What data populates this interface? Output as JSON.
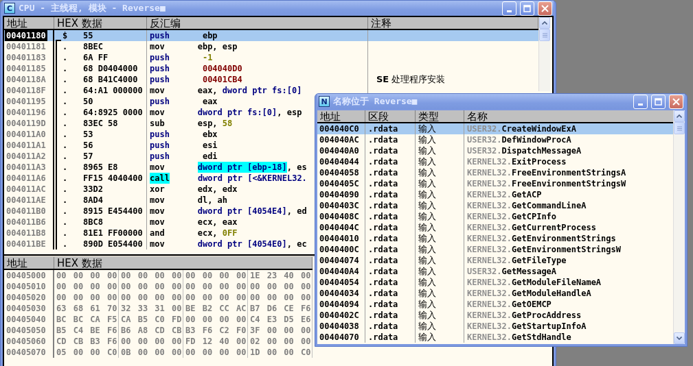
{
  "cpu_window": {
    "icon": "C",
    "title": "CPU -  主线程, 模块 - Reverse■",
    "disasm": {
      "columns": [
        "地址",
        "HEX 数据",
        "反汇编",
        "注释"
      ],
      "rows": [
        {
          "address": "00401180",
          "marker": "$",
          "bracket_start": true,
          "hex": "55",
          "op": "push",
          "kind": "stack",
          "op_highlight": false,
          "operands": [
            {
              "text": "ebp",
              "kind": "reg",
              "highlight": false
            }
          ],
          "selected": true
        },
        {
          "address": "00401181",
          "marker": ".",
          "bracket_start": false,
          "hex": "8BEC",
          "op": "mov",
          "kind": "plain",
          "op_highlight": false,
          "operands": [
            {
              "text": "ebp, esp",
              "kind": "reg",
              "highlight": false
            }
          ],
          "selected": false
        },
        {
          "address": "00401183",
          "marker": ".",
          "bracket_start": false,
          "hex": "6A FF",
          "op": "push",
          "kind": "stack",
          "op_highlight": false,
          "operands": [
            {
              "text": "-1",
              "kind": "imm",
              "highlight": false
            }
          ],
          "selected": false
        },
        {
          "address": "00401185",
          "marker": ".",
          "bracket_start": false,
          "hex": "68 D0404000",
          "op": "push",
          "kind": "stack",
          "op_highlight": false,
          "operands": [
            {
              "text": "004040D0",
              "kind": "addr",
              "highlight": false
            }
          ],
          "selected": false
        },
        {
          "address": "0040118A",
          "marker": ".",
          "bracket_start": false,
          "hex": "68 B41C4000",
          "op": "push",
          "kind": "stack",
          "op_highlight": false,
          "operands": [
            {
              "text": "00401CB4",
              "kind": "addr",
              "highlight": false
            }
          ],
          "comment": "**SE** 处理程序安装",
          "selected": false
        },
        {
          "address": "0040118F",
          "marker": ".",
          "bracket_start": false,
          "hex": "64:A1 000000",
          "op": "mov",
          "kind": "plain",
          "op_highlight": false,
          "operands": [
            {
              "text": "eax, ",
              "kind": "reg",
              "highlight": false
            },
            {
              "text": "dword ptr fs:[0]",
              "kind": "mem",
              "highlight": false
            }
          ],
          "selected": false
        },
        {
          "address": "00401195",
          "marker": ".",
          "bracket_start": false,
          "hex": "50",
          "op": "push",
          "kind": "stack",
          "op_highlight": false,
          "operands": [
            {
              "text": "eax",
              "kind": "reg",
              "highlight": false
            }
          ],
          "selected": false
        },
        {
          "address": "00401196",
          "marker": ".",
          "bracket_start": false,
          "hex": "64:8925 0000",
          "op": "mov",
          "kind": "plain",
          "op_highlight": false,
          "operands": [
            {
              "text": "dword ptr fs:[0]",
              "kind": "mem",
              "highlight": false
            },
            {
              "text": ", esp",
              "kind": "reg",
              "highlight": false
            }
          ],
          "selected": false
        },
        {
          "address": "0040119D",
          "marker": ".",
          "bracket_start": false,
          "hex": "83EC 58",
          "op": "sub",
          "kind": "plain",
          "op_highlight": false,
          "operands": [
            {
              "text": "esp, ",
              "kind": "reg",
              "highlight": false
            },
            {
              "text": "58",
              "kind": "imm",
              "highlight": false
            }
          ],
          "selected": false
        },
        {
          "address": "004011A0",
          "marker": ".",
          "bracket_start": false,
          "hex": "53",
          "op": "push",
          "kind": "stack",
          "op_highlight": false,
          "operands": [
            {
              "text": "ebx",
              "kind": "reg",
              "highlight": false
            }
          ],
          "selected": false
        },
        {
          "address": "004011A1",
          "marker": ".",
          "bracket_start": false,
          "hex": "56",
          "op": "push",
          "kind": "stack",
          "op_highlight": false,
          "operands": [
            {
              "text": "esi",
              "kind": "reg",
              "highlight": false
            }
          ],
          "selected": false
        },
        {
          "address": "004011A2",
          "marker": ".",
          "bracket_start": false,
          "hex": "57",
          "op": "push",
          "kind": "stack",
          "op_highlight": false,
          "operands": [
            {
              "text": "edi",
              "kind": "reg",
              "highlight": false
            }
          ],
          "selected": false
        },
        {
          "address": "004011A3",
          "marker": ".",
          "bracket_start": false,
          "hex": "8965 E8",
          "op": "mov",
          "kind": "plain",
          "op_highlight": false,
          "operands": [
            {
              "text": "dword ptr [ebp-18]",
              "kind": "mem",
              "highlight": true
            },
            {
              "text": ", es",
              "kind": "reg",
              "highlight": false
            }
          ],
          "selected": false
        },
        {
          "address": "004011A6",
          "marker": ".",
          "bracket_start": false,
          "hex": "FF15 4040400",
          "op": "call",
          "kind": "plain",
          "op_highlight": true,
          "operands": [
            {
              "text": "dword ptr [<&KERNEL32.",
              "kind": "mem",
              "highlight": false
            }
          ],
          "selected": false
        },
        {
          "address": "004011AC",
          "marker": ".",
          "bracket_start": false,
          "hex": "33D2",
          "op": "xor",
          "kind": "plain",
          "op_highlight": false,
          "operands": [
            {
              "text": "edx, edx",
              "kind": "reg",
              "highlight": false
            }
          ],
          "selected": false
        },
        {
          "address": "004011AE",
          "marker": ".",
          "bracket_start": false,
          "hex": "8AD4",
          "op": "mov",
          "kind": "plain",
          "op_highlight": false,
          "operands": [
            {
              "text": "dl, ah",
              "kind": "reg",
              "highlight": false
            }
          ],
          "selected": false
        },
        {
          "address": "004011B0",
          "marker": ".",
          "bracket_start": false,
          "hex": "8915 E454400",
          "op": "mov",
          "kind": "plain",
          "op_highlight": false,
          "operands": [
            {
              "text": "dword ptr [4054E4]",
              "kind": "mem",
              "highlight": false
            },
            {
              "text": ", ed",
              "kind": "reg",
              "highlight": false
            }
          ],
          "selected": false
        },
        {
          "address": "004011B6",
          "marker": ".",
          "bracket_start": false,
          "hex": "8BC8",
          "op": "mov",
          "kind": "plain",
          "op_highlight": false,
          "operands": [
            {
              "text": "ecx, eax",
              "kind": "reg",
              "highlight": false
            }
          ],
          "selected": false
        },
        {
          "address": "004011B8",
          "marker": ".",
          "bracket_start": false,
          "hex": "81E1 FF00000",
          "op": "and",
          "kind": "plain",
          "op_highlight": false,
          "operands": [
            {
              "text": "ecx, ",
              "kind": "reg",
              "highlight": false
            },
            {
              "text": "0FF",
              "kind": "imm",
              "highlight": false
            }
          ],
          "selected": false
        },
        {
          "address": "004011BE",
          "marker": ".",
          "bracket_start": false,
          "hex": "890D E054400",
          "op": "mov",
          "kind": "plain",
          "op_highlight": false,
          "operands": [
            {
              "text": "dword ptr [4054E0]",
              "kind": "mem",
              "highlight": false
            },
            {
              "text": ", ec",
              "kind": "reg",
              "highlight": false
            }
          ],
          "selected": false
        }
      ]
    },
    "dump": {
      "columns": [
        "地址",
        "HEX 数据"
      ],
      "rows": [
        {
          "address": "00405000",
          "groups": [
            "00 00 00 00",
            "00 00 00 00",
            "00 00 00 00",
            "1E 23 40 00"
          ]
        },
        {
          "address": "00405010",
          "groups": [
            "00 00 00 00",
            "00 00 00 00",
            "00 00 00 00",
            "00 00 00 00"
          ]
        },
        {
          "address": "00405020",
          "groups": [
            "00 00 00 00",
            "00 00 00 00",
            "00 00 00 00",
            "00 00 00 00"
          ]
        },
        {
          "address": "00405030",
          "groups": [
            "63 68 61 70",
            "32 33 31 00",
            "BE B2 CC AC",
            "B7 D6 CE F6"
          ]
        },
        {
          "address": "00405040",
          "groups": [
            "BC BC CA F5",
            "CA B5 C0 FD",
            "00 00 00 00",
            "C4 E3 D5 E6"
          ]
        },
        {
          "address": "00405050",
          "groups": [
            "B5 C4 BE F6",
            "B6 A8 CD CB",
            "B3 F6 C2 F0",
            "3F 00 00 00"
          ]
        },
        {
          "address": "00405060",
          "groups": [
            "CD CB B3 F6",
            "00 00 00 00",
            "FD 12 40 00",
            "02 00 00 00"
          ]
        },
        {
          "address": "00405070",
          "groups": [
            "05 00 00 C0",
            "0B 00 00 00",
            "00 00 00 00",
            "1D 00 00 C0"
          ]
        }
      ]
    }
  },
  "names_window": {
    "icon": "N",
    "title": "名称位于 Reverse■",
    "columns": [
      "地址",
      "区段",
      "类型",
      "名称"
    ],
    "rows": [
      {
        "address": "004040C0",
        "section": ".rdata",
        "type": "输入",
        "module": "USER32.",
        "name": "CreateWindowExA",
        "selected": true
      },
      {
        "address": "004040AC",
        "section": ".rdata",
        "type": "输入",
        "module": "USER32.",
        "name": "DefWindowProcA",
        "selected": false
      },
      {
        "address": "004040A0",
        "section": ".rdata",
        "type": "输入",
        "module": "USER32.",
        "name": "DispatchMessageA",
        "selected": false
      },
      {
        "address": "00404044",
        "section": ".rdata",
        "type": "输入",
        "module": "KERNEL32.",
        "name": "ExitProcess",
        "selected": false
      },
      {
        "address": "00404058",
        "section": ".rdata",
        "type": "输入",
        "module": "KERNEL32.",
        "name": "FreeEnvironmentStringsA",
        "selected": false
      },
      {
        "address": "0040405C",
        "section": ".rdata",
        "type": "输入",
        "module": "KERNEL32.",
        "name": "FreeEnvironmentStringsW",
        "selected": false
      },
      {
        "address": "00404090",
        "section": ".rdata",
        "type": "输入",
        "module": "KERNEL32.",
        "name": "GetACP",
        "selected": false
      },
      {
        "address": "0040403C",
        "section": ".rdata",
        "type": "输入",
        "module": "KERNEL32.",
        "name": "GetCommandLineA",
        "selected": false
      },
      {
        "address": "0040408C",
        "section": ".rdata",
        "type": "输入",
        "module": "KERNEL32.",
        "name": "GetCPInfo",
        "selected": false
      },
      {
        "address": "0040404C",
        "section": ".rdata",
        "type": "输入",
        "module": "KERNEL32.",
        "name": "GetCurrentProcess",
        "selected": false
      },
      {
        "address": "00404010",
        "section": ".rdata",
        "type": "输入",
        "module": "KERNEL32.",
        "name": "GetEnvironmentStrings",
        "selected": false
      },
      {
        "address": "0040400C",
        "section": ".rdata",
        "type": "输入",
        "module": "KERNEL32.",
        "name": "GetEnvironmentStringsW",
        "selected": false
      },
      {
        "address": "00404074",
        "section": ".rdata",
        "type": "输入",
        "module": "KERNEL32.",
        "name": "GetFileType",
        "selected": false
      },
      {
        "address": "004040A4",
        "section": ".rdata",
        "type": "输入",
        "module": "USER32.",
        "name": "GetMessageA",
        "selected": false
      },
      {
        "address": "00404054",
        "section": ".rdata",
        "type": "输入",
        "module": "KERNEL32.",
        "name": "GetModuleFileNameA",
        "selected": false
      },
      {
        "address": "00404034",
        "section": ".rdata",
        "type": "输入",
        "module": "KERNEL32.",
        "name": "GetModuleHandleA",
        "selected": false
      },
      {
        "address": "00404094",
        "section": ".rdata",
        "type": "输入",
        "module": "KERNEL32.",
        "name": "GetOEMCP",
        "selected": false
      },
      {
        "address": "0040402C",
        "section": ".rdata",
        "type": "输入",
        "module": "KERNEL32.",
        "name": "GetProcAddress",
        "selected": false
      },
      {
        "address": "00404038",
        "section": ".rdata",
        "type": "输入",
        "module": "KERNEL32.",
        "name": "GetStartupInfoA",
        "selected": false
      },
      {
        "address": "00404070",
        "section": ".rdata",
        "type": "输入",
        "module": "KERNEL32.",
        "name": "GetStdHandle",
        "selected": false
      }
    ]
  }
}
